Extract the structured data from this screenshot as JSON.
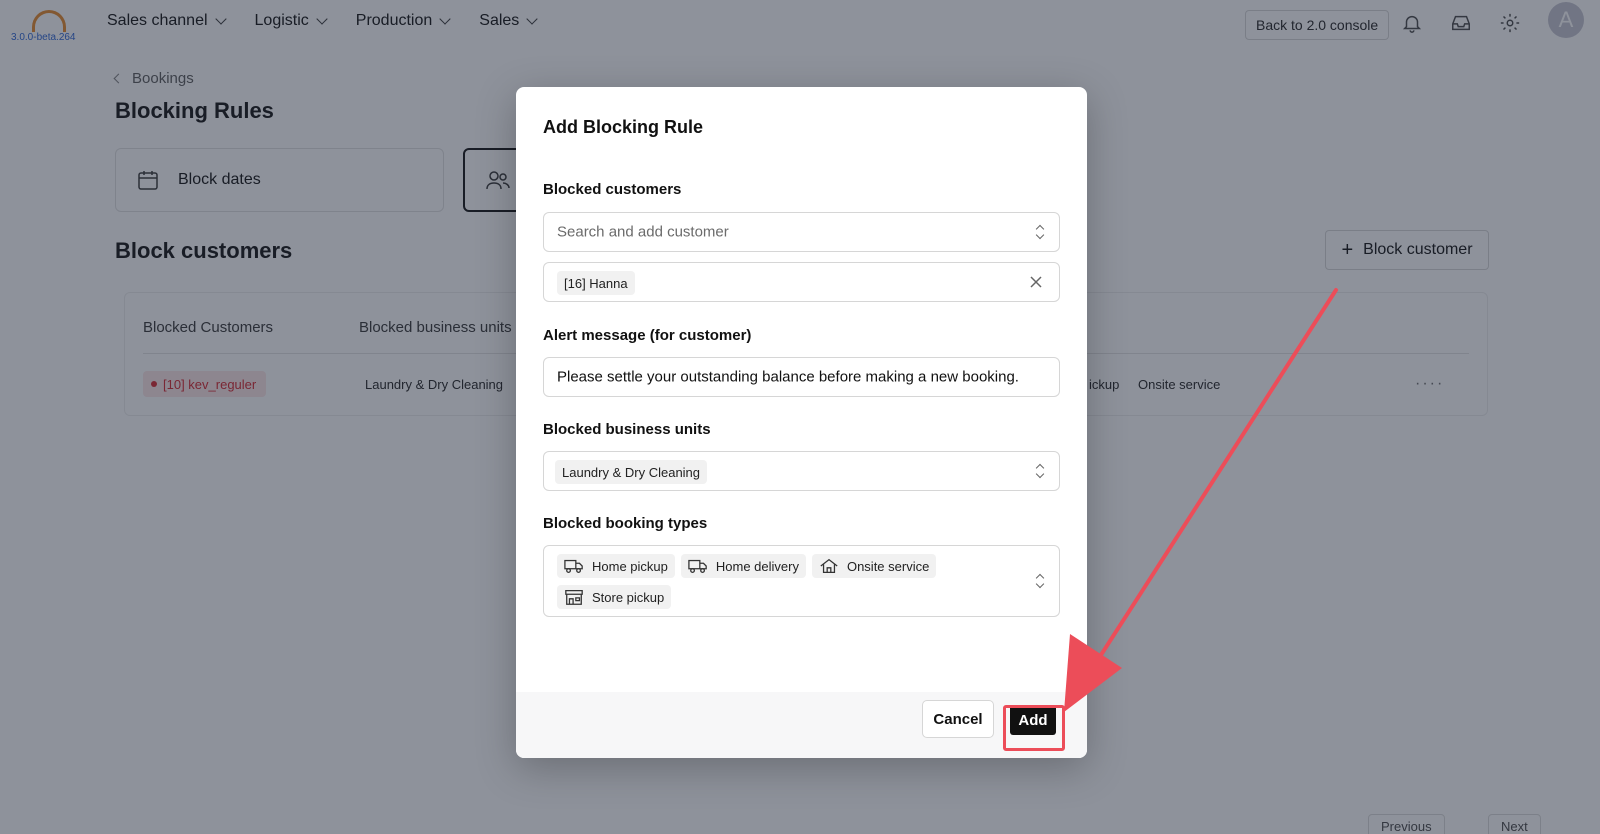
{
  "app": {
    "version": "3.0.0-beta.264",
    "nav": [
      "Sales channel",
      "Logistic",
      "Production",
      "Sales"
    ],
    "back_console": "Back to 2.0 console",
    "avatar_letter": "A"
  },
  "page": {
    "breadcrumb": "Bookings",
    "title": "Blocking Rules",
    "cards": {
      "block_dates": "Block dates"
    },
    "section_title": "Block customers",
    "block_customer_button": "Block customer",
    "table": {
      "headers": [
        "Blocked Customers",
        "Blocked business units"
      ],
      "row": {
        "customer": "[10] kev_reguler",
        "business_unit": "Laundry & Dry Cleaning",
        "types_tail": "ickup",
        "type_onsite": "Onsite service",
        "actions": "····"
      }
    },
    "pager": {
      "prev": "Previous",
      "next": "Next"
    }
  },
  "modal": {
    "title": "Add Blocking Rule",
    "customers_label": "Blocked customers",
    "search_placeholder": "Search and add customer",
    "selected_customer": "[16] Hanna",
    "alert_label": "Alert message (for customer)",
    "alert_value": "Please settle your outstanding balance before making a new booking.",
    "business_units_label": "Blocked business units",
    "business_unit_value": "Laundry & Dry Cleaning",
    "booking_types_label": "Blocked booking types",
    "booking_types": [
      "Home pickup",
      "Home delivery",
      "Onsite service",
      "Store pickup"
    ],
    "cancel_label": "Cancel",
    "add_label": "Add"
  },
  "colors": {
    "overlay": "#0f172a",
    "annotation_red": "#ec4d59",
    "primary_button": "#111111",
    "danger_tag": "#d9363e"
  }
}
